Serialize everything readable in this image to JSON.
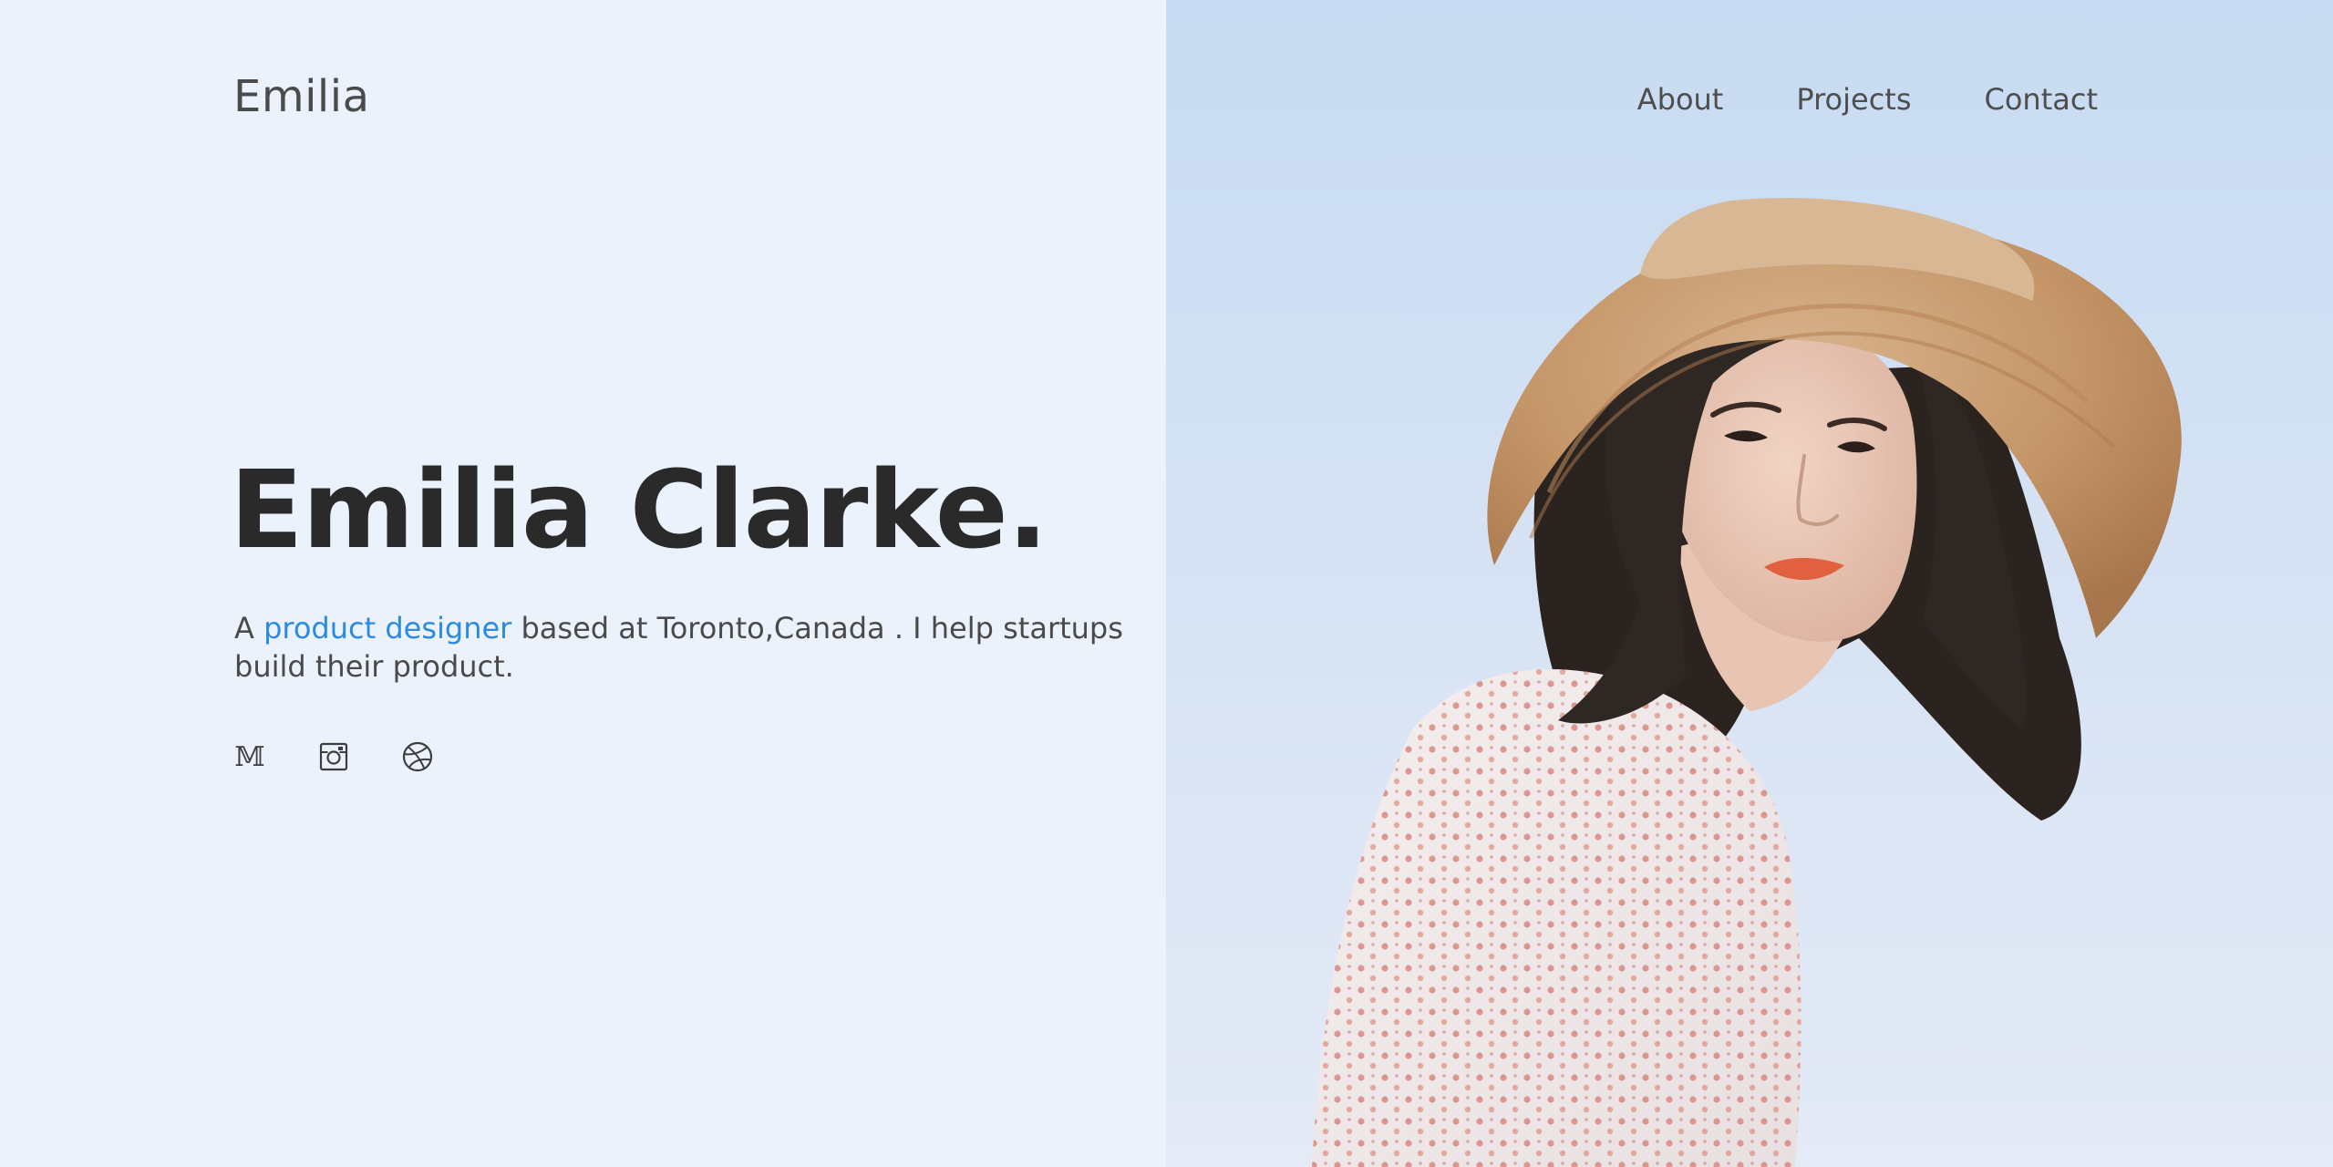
{
  "brand": {
    "logo": "Emilia"
  },
  "nav": {
    "items": [
      "About",
      "Projects",
      "Contact"
    ]
  },
  "hero": {
    "title": "Emilia Clarke.",
    "desc_prefix": "A ",
    "desc_accent": "product designer",
    "desc_suffix": " based at Toronto,Canada . I help startups build their product."
  },
  "socials": {
    "medium_glyph": "𝕄",
    "icons": [
      "medium-icon",
      "instagram-icon",
      "dribbble-icon"
    ]
  },
  "colors": {
    "background": "#ecf2fc",
    "accent": "#2b8be0",
    "text_dark": "#2a2a2a",
    "text_body": "#4a4a4a"
  }
}
